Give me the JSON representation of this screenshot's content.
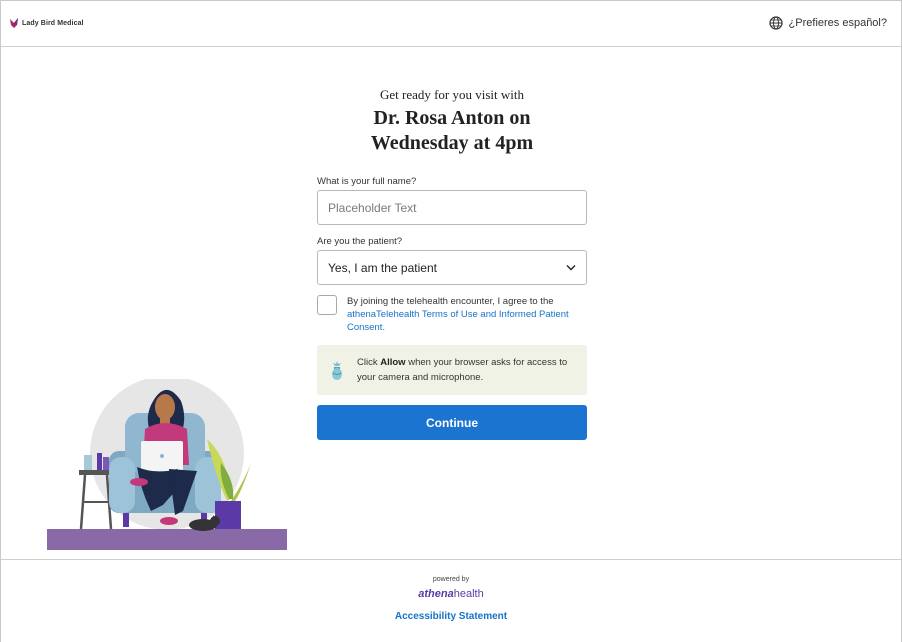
{
  "header": {
    "brand_name": "Lady Bird Medical",
    "language_toggle": "¿Prefieres español?"
  },
  "intro": {
    "subtitle": "Get ready for you visit with",
    "title_line1": "Dr. Rosa Anton on",
    "title_line2": "Wednesday at 4pm"
  },
  "form": {
    "name_label": "What is your full name?",
    "name_placeholder": "Placeholder Text",
    "name_value": "",
    "patient_label": "Are you the patient?",
    "patient_selected": "Yes, I am the patient",
    "agree_text": "By joining the telehealth encounter, I agree to the",
    "agree_link": "athenaTelehealth Terms of Use and Informed Patient Consent.",
    "agree_checked": false
  },
  "notice": {
    "prefix": "Click",
    "bold": "Allow",
    "suffix": "when your browser asks for access to your camera and microphone."
  },
  "continue_label": "Continue",
  "footer": {
    "powered_by": "powered by",
    "athena_prefix": "athena",
    "athena_suffix": "health",
    "accessibility": "Accessibility Statement"
  },
  "colors": {
    "primary": "#1b75d0",
    "link": "#1673c9",
    "notice_bg": "#f1f2e6",
    "brand_purple": "#5b3aa8"
  }
}
